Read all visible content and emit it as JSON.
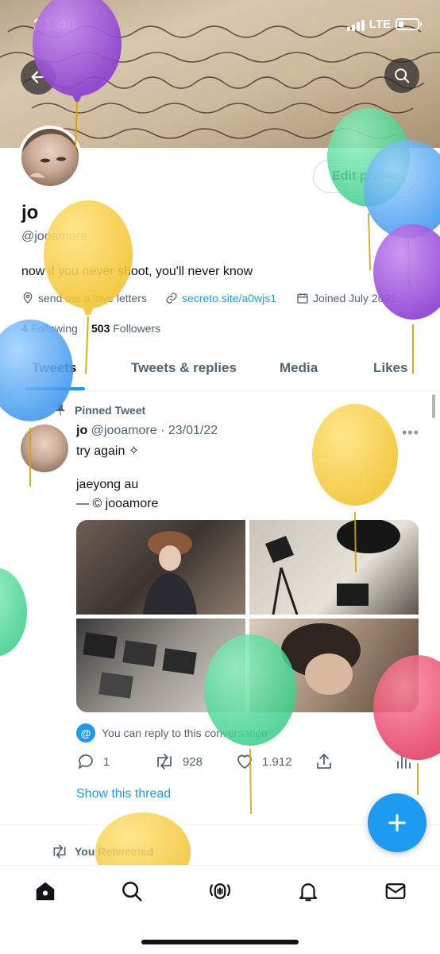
{
  "status_bar": {
    "time": "21.40",
    "network": "LTE",
    "battery_level": 0.25
  },
  "header": {
    "back_icon": "arrow-left-icon",
    "search_icon": "search-icon"
  },
  "profile": {
    "name": "jo",
    "handle": "@jooamore",
    "bio": "now if you never shoot, you'll never know",
    "location": "send me a love letters",
    "website": "secreto.site/a0wjs1",
    "joined": "Joined July 2021",
    "following_count": "4",
    "following_label": "Following",
    "followers_count": "503",
    "followers_label": "Followers",
    "edit_button": "Edit profile"
  },
  "tabs": [
    "Tweets",
    "Tweets & replies",
    "Media",
    "Likes"
  ],
  "active_tab": "Tweets",
  "pinned_tweet": {
    "pinned_label": "Pinned Tweet",
    "author_name": "jo",
    "author_handle": "@jooamore",
    "date": "· 23/01/22",
    "line1": "try again ✧",
    "line2": "jaeyong au",
    "line3": "— © jooamore",
    "reply_note": "You can reply to this conversation",
    "replies": "1",
    "retweets": "928",
    "likes": "1.912",
    "show_thread": "Show this thread"
  },
  "next_item": {
    "retweeted_label": "You Retweeted"
  },
  "colors": {
    "accent": "#1d9bf0",
    "text": "#0f1419",
    "muted": "#536471"
  },
  "nav": [
    "home-icon",
    "explore-icon",
    "spaces-icon",
    "notifications-icon",
    "messages-icon"
  ]
}
